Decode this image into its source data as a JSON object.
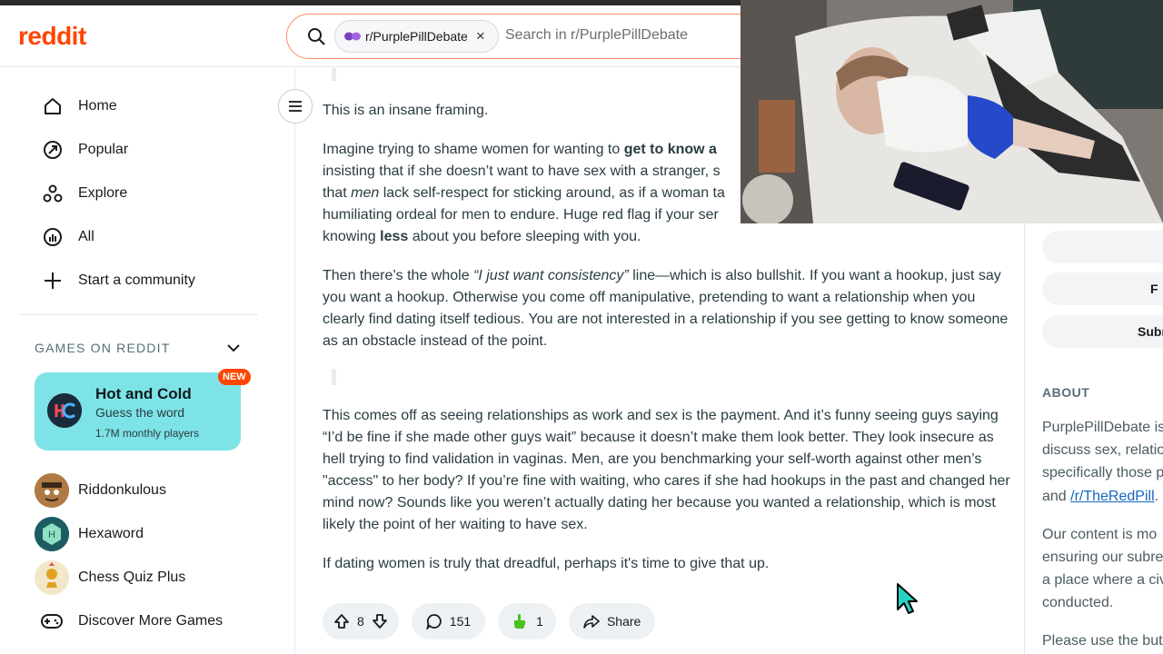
{
  "header": {
    "logo_text": "reddit",
    "search_chip": "r/PurplePillDebate",
    "search_chip_close": "×",
    "search_placeholder": "Search in r/PurplePillDebate"
  },
  "sidebar": {
    "nav": [
      {
        "label": "Home",
        "icon": "home-icon"
      },
      {
        "label": "Popular",
        "icon": "popular-icon"
      },
      {
        "label": "Explore",
        "icon": "explore-icon"
      },
      {
        "label": "All",
        "icon": "all-icon"
      },
      {
        "label": "Start a community",
        "icon": "plus-icon"
      }
    ],
    "games_header": "GAMES ON REDDIT",
    "featured_game": {
      "title": "Hot and Cold",
      "subtitle": "Guess the word",
      "players": "1.7M monthly players",
      "badge": "NEW"
    },
    "games": [
      "Riddonkulous",
      "Hexaword",
      "Chess Quiz Plus",
      "Discover More Games"
    ]
  },
  "post": {
    "p1": "This is an insane framing.",
    "p2_line1_a": "Imagine trying to shame women for wanting to ",
    "p2_line1_b": "get to know a",
    "p2_line2": "insisting that if she doesn’t want to have sex with a stranger, s",
    "p2_line3_a": "that ",
    "p2_line3_b": "men",
    "p2_line3_c": " lack self-respect for sticking around, as if a woman ta",
    "p2_line4": "humiliating ordeal for men to endure. Huge red flag if your ser",
    "p2_line5_a": "knowing ",
    "p2_line5_b": "less",
    "p2_line5_c": " about you before sleeping with you.",
    "p3_a": "Then there’s the whole ",
    "p3_b": "“I just want consistency”",
    "p3_c": " line—which is also bullshit. If you want a hookup, just say you want a hookup. Otherwise you come off manipulative, pretending to want a relationship when you clearly find dating itself tedious. You are not interested in a relationship if you see getting to know someone as an obstacle instead of the point.",
    "p4": "This comes off as seeing relationships as work and sex is the payment. And it’s funny seeing guys saying “I’d be fine if she made other guys wait” because it doesn’t make them look better. They look insecure as hell trying to find validation in vaginas. Men, are you benchmarking your self-worth against other men’s \"access\" to her body? If you’re fine with waiting, who cares if she had hookups in the past and changed her mind now? Sounds like you weren’t actually dating her because you wanted a relationship, which is most likely the point of her waiting to have sex.",
    "p5": "If dating women is truly that dreadful, perhaps it's time to give that up.",
    "votes": "8",
    "comments": "151",
    "awards": "1",
    "share": "Share"
  },
  "right_panel": {
    "btn2_partial": "F",
    "btn3_partial": "Subr",
    "about_title": "ABOUT",
    "about_line1": "PurplePillDebate is",
    "about_line2": "discuss sex, relatio",
    "about_line3": "specifically those p",
    "about_line4_a": "and ",
    "about_line4_link": "/r/TheRedPill",
    "about_line4_b": ".",
    "about2_line1": "Our content is mo",
    "about2_line2": "ensuring our subre",
    "about2_line3": "a place where a civ",
    "about2_line4": "conducted.",
    "about3_line1": "Please use the but"
  }
}
